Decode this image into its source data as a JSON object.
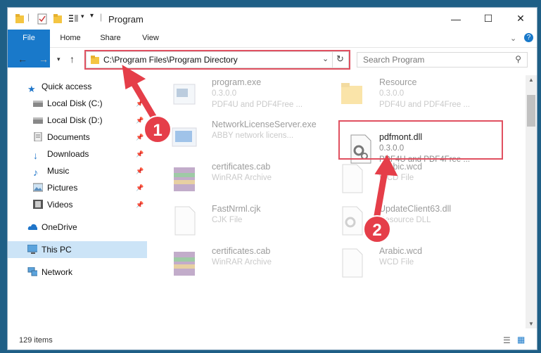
{
  "window": {
    "title": "Program"
  },
  "ribbon": {
    "tabs": [
      "File",
      "Home",
      "Share",
      "View"
    ]
  },
  "address": {
    "path": "C:\\Program Files\\Program Directory"
  },
  "search": {
    "placeholder": "Search Program"
  },
  "sidebar": {
    "items": [
      {
        "label": "Quick access",
        "icon": "star-icon"
      },
      {
        "label": "Local Disk (C:)",
        "icon": "drive-icon"
      },
      {
        "label": "Local Disk (D:)",
        "icon": "drive-icon"
      },
      {
        "label": "Documents",
        "icon": "documents-icon"
      },
      {
        "label": "Downloads",
        "icon": "download-icon"
      },
      {
        "label": "Music",
        "icon": "music-icon"
      },
      {
        "label": "Pictures",
        "icon": "pictures-icon"
      },
      {
        "label": "Videos",
        "icon": "videos-icon"
      },
      {
        "label": "OneDrive",
        "icon": "cloud-icon"
      },
      {
        "label": "This PC",
        "icon": "computer-icon"
      },
      {
        "label": "Network",
        "icon": "network-icon"
      }
    ]
  },
  "files": [
    {
      "name": "program.exe",
      "version": "0.3.0.0",
      "desc": "PDF4U and PDF4Free ..."
    },
    {
      "name": "Resource",
      "version": "0.3.0.0",
      "desc": "PDF4U and PDF4Free ..."
    },
    {
      "name": "NetworkLicenseServer.exe",
      "version": "",
      "desc": "ABBY network licens..."
    },
    {
      "name": "pdfmont.dll",
      "version": "0.3.0.0",
      "desc": "PDF4U and PDF4Free ..."
    },
    {
      "name": "certificates.cab",
      "version": "",
      "desc": "WinRAR Archive"
    },
    {
      "name": "Arabic.wcd",
      "version": "",
      "desc": "WCD File"
    },
    {
      "name": "FastNrml.cjk",
      "version": "",
      "desc": "CJK File"
    },
    {
      "name": "UpdateClient63.dll",
      "version": "",
      "desc": "Resource DLL"
    },
    {
      "name": "certificates.cab",
      "version": "",
      "desc": "WinRAR Archive"
    },
    {
      "name": "Arabic.wcd",
      "version": "",
      "desc": "WCD File"
    }
  ],
  "status": {
    "item_count": "129 items"
  },
  "callouts": [
    "1",
    "2"
  ],
  "colors": {
    "accent": "#1979ca",
    "highlight": "#e05060",
    "selected": "#cce4f7"
  }
}
